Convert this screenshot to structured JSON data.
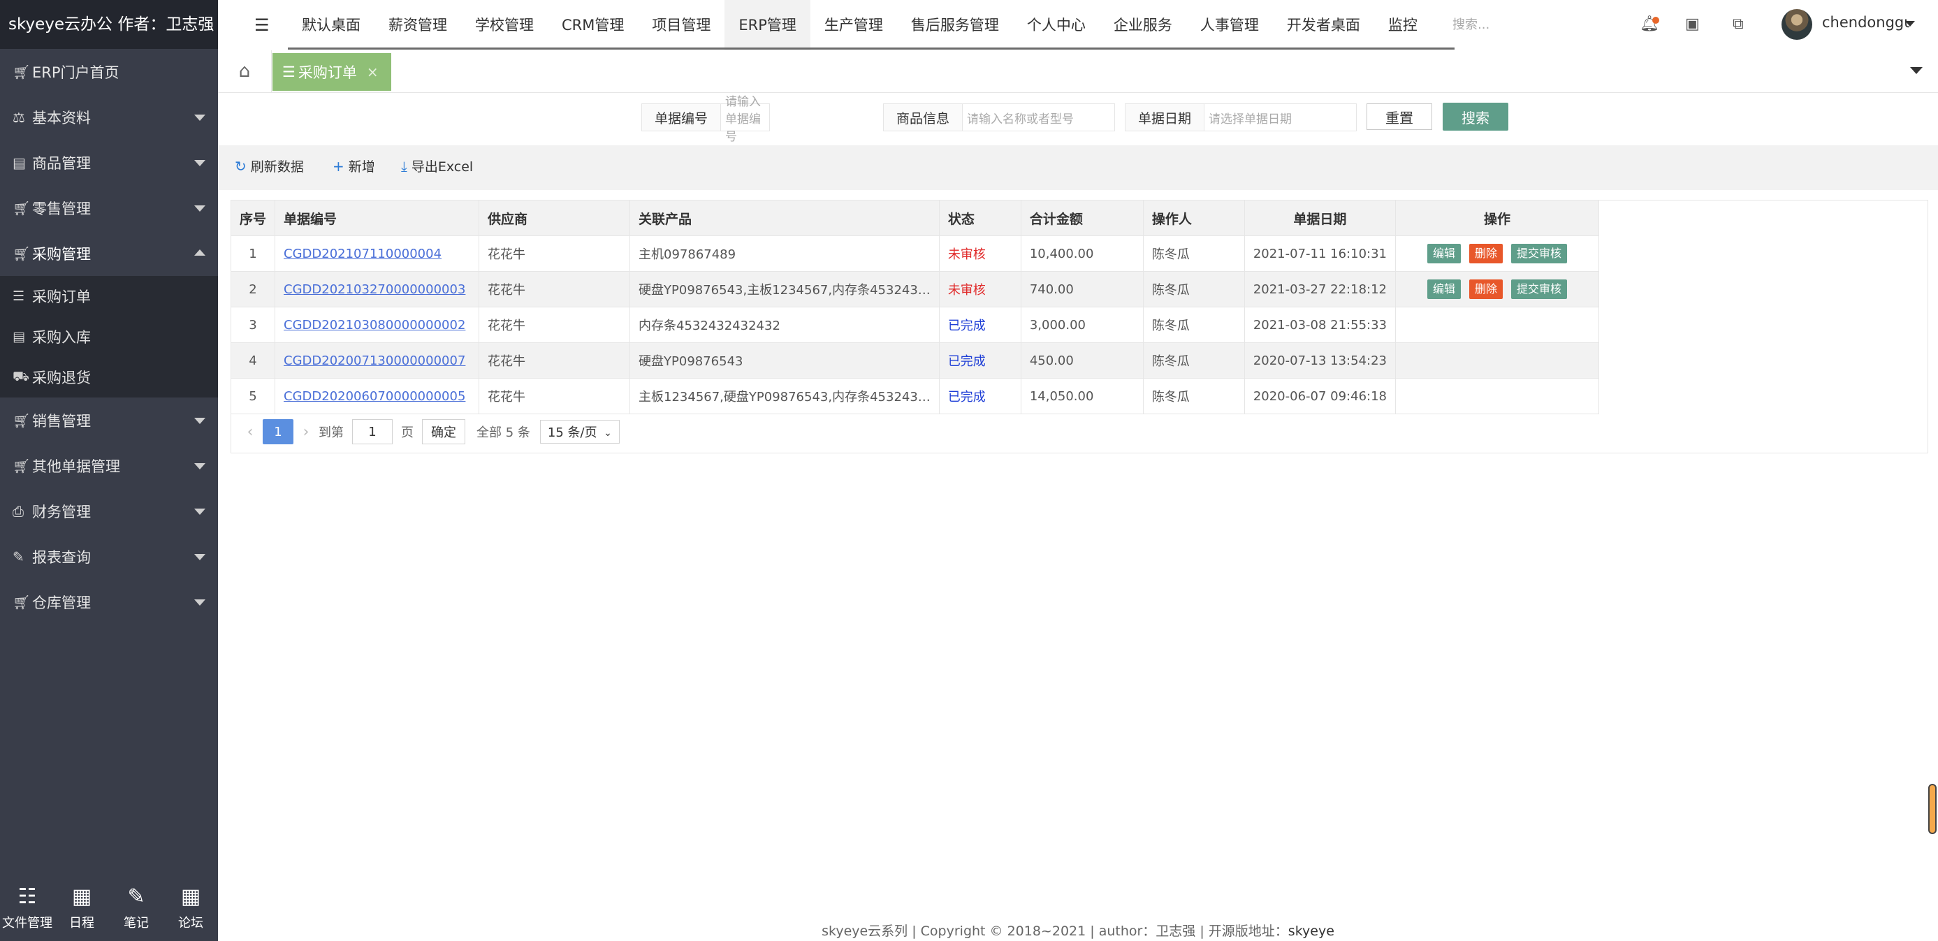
{
  "app": {
    "logo": "skyeye云办公 作者：卫志强"
  },
  "sidebar": {
    "items": [
      {
        "label": "ERP门户首页",
        "icon": "cart-icon",
        "has_caret": false
      },
      {
        "label": "基本资料",
        "icon": "scale-icon",
        "has_caret": true
      },
      {
        "label": "商品管理",
        "icon": "box-icon",
        "has_caret": true
      },
      {
        "label": "零售管理",
        "icon": "cart-icon",
        "has_caret": true
      },
      {
        "label": "采购管理",
        "icon": "cart-icon",
        "has_caret": true,
        "open": true
      }
    ],
    "submenu": [
      {
        "label": "采购订单",
        "icon": "list-icon"
      },
      {
        "label": "采购入库",
        "icon": "box-icon"
      },
      {
        "label": "采购退货",
        "icon": "truck-icon"
      }
    ],
    "items_after": [
      {
        "label": "销售管理",
        "icon": "cart-icon"
      },
      {
        "label": "其他单据管理",
        "icon": "cart-icon"
      },
      {
        "label": "财务管理",
        "icon": "print-icon"
      },
      {
        "label": "报表查询",
        "icon": "edit-icon"
      },
      {
        "label": "仓库管理",
        "icon": "cart-icon"
      }
    ],
    "bottom": [
      {
        "label": "文件管理",
        "icon": "list-icon"
      },
      {
        "label": "日程",
        "icon": "calendar-icon"
      },
      {
        "label": "笔记",
        "icon": "edit-icon"
      },
      {
        "label": "论坛",
        "icon": "calendar-icon"
      }
    ]
  },
  "topnav": {
    "items": [
      "默认桌面",
      "薪资管理",
      "学校管理",
      "CRM管理",
      "项目管理",
      "ERP管理",
      "生产管理",
      "售后服务管理",
      "个人中心",
      "企业服务",
      "人事管理",
      "开发者桌面",
      "监控"
    ],
    "active_index": 5,
    "search_placeholder": "搜索...",
    "username": "chendonggua"
  },
  "tabs": {
    "active_label": "采购订单",
    "close": "×"
  },
  "search": {
    "bill_no_label": "单据编号",
    "bill_no_placeholder": "请输入单据编号",
    "goods_label": "商品信息",
    "goods_placeholder": "请输入名称或者型号",
    "date_label": "单据日期",
    "date_placeholder": "请选择单据日期",
    "reset": "重置",
    "search": "搜索"
  },
  "toolbar": {
    "refresh": "刷新数据",
    "add": "新增",
    "export": "导出Excel"
  },
  "table": {
    "headers": [
      "序号",
      "单据编号",
      "供应商",
      "关联产品",
      "状态",
      "合计金额",
      "操作人",
      "单据日期",
      "操作"
    ],
    "rows": [
      {
        "no": "1",
        "bill": "CGDD202107110000004",
        "supplier": "花花牛",
        "product": "主机097867489",
        "status": "未审核",
        "amount": "10,400.00",
        "operator": "陈冬瓜",
        "date": "2021-07-11 16:10:31",
        "ops": true
      },
      {
        "no": "2",
        "bill": "CGDD202103270000000003",
        "supplier": "花花牛",
        "product": "硬盘YP09876543,主板1234567,内存条453243…",
        "status": "未审核",
        "amount": "740.00",
        "operator": "陈冬瓜",
        "date": "2021-03-27 22:18:12",
        "ops": true
      },
      {
        "no": "3",
        "bill": "CGDD202103080000000002",
        "supplier": "花花牛",
        "product": "内存条4532432432432",
        "status": "已完成",
        "amount": "3,000.00",
        "operator": "陈冬瓜",
        "date": "2021-03-08 21:55:33",
        "ops": false
      },
      {
        "no": "4",
        "bill": "CGDD202007130000000007",
        "supplier": "花花牛",
        "product": "硬盘YP09876543",
        "status": "已完成",
        "amount": "450.00",
        "operator": "陈冬瓜",
        "date": "2020-07-13 13:54:23",
        "ops": false
      },
      {
        "no": "5",
        "bill": "CGDD202006070000000005",
        "supplier": "花花牛",
        "product": "主板1234567,硬盘YP09876543,内存条453243…",
        "status": "已完成",
        "amount": "14,050.00",
        "operator": "陈冬瓜",
        "date": "2020-06-07 09:46:18",
        "ops": false
      }
    ],
    "op_labels": {
      "edit": "编辑",
      "delete": "删除",
      "audit": "提交审核"
    }
  },
  "pager": {
    "current": "1",
    "goto_label": "到第",
    "goto_value": "1",
    "page_unit": "页",
    "confirm": "确定",
    "total": "全部 5 条",
    "page_size": "15 条/页"
  },
  "footer": {
    "text": "skyeye云系列 | Copyright © 2018~2021 | author：卫志强 | 开源版地址：",
    "link": "skyeye"
  },
  "colors": {
    "sidebar_bg": "#393d49",
    "accent_green": "#5f9e8a",
    "tab_green": "#8fbf76",
    "status_pending": "#e02a2a",
    "status_done": "#1e3ed6",
    "delete_orange": "#e8572a"
  }
}
